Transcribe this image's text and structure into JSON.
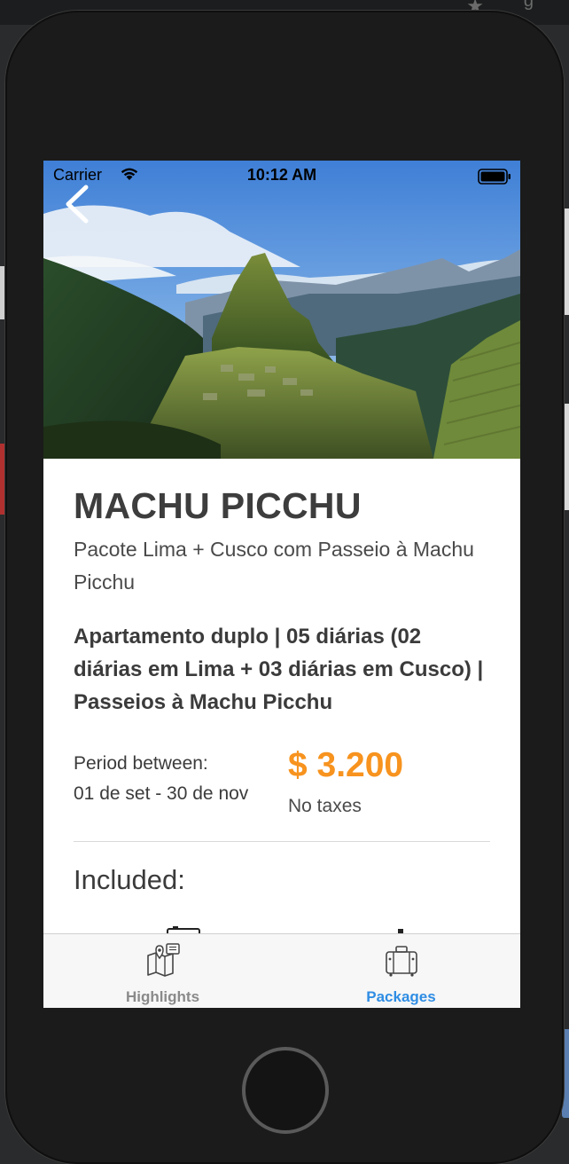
{
  "status_bar": {
    "carrier": "Carrier",
    "time": "10:12 AM"
  },
  "hero": {
    "image_subject": "Machu Picchu mountain landscape"
  },
  "package": {
    "title": "MACHU PICCHU",
    "subtitle": "Pacote Lima + Cusco com Passeio à Machu Picchu",
    "details": "Apartamento duplo | 05 diárias (02 diárias em Lima + 03 diárias em Cusco) | Passeios à Machu Picchu",
    "period_label": "Period between:",
    "period_dates": "01 de set - 30 de nov",
    "price": "$ 3.200",
    "price_note": "No taxes",
    "included_heading": "Included:"
  },
  "tabs": [
    {
      "label": "Highlights",
      "icon": "map-location-icon",
      "active": false
    },
    {
      "label": "Packages",
      "icon": "luggage-icon",
      "active": true
    }
  ],
  "colors": {
    "accent_orange": "#f7931e",
    "active_tab_blue": "#2f8de4",
    "inactive_tab_gray": "#8a8a8a",
    "title_text": "#3d3d3d"
  }
}
